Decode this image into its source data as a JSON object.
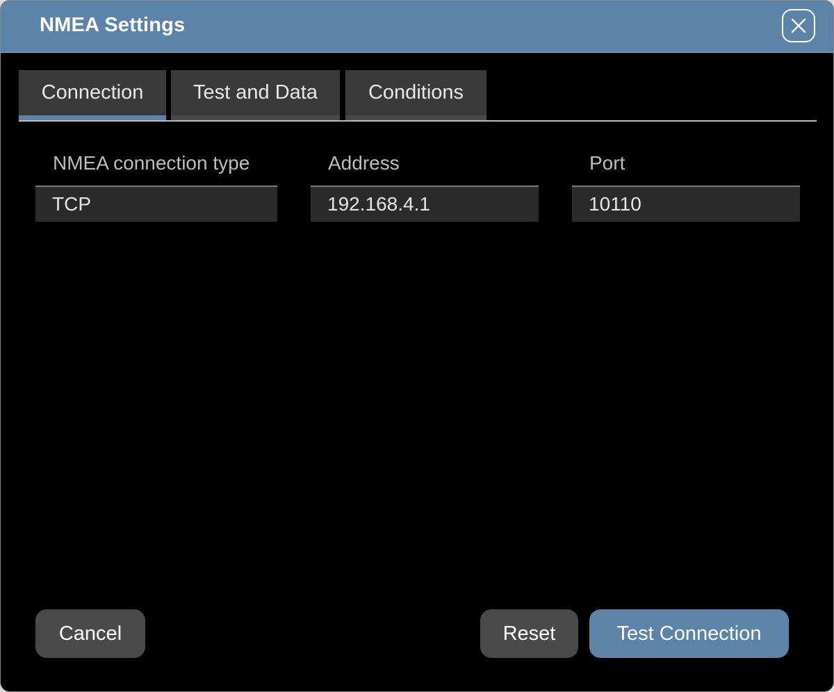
{
  "dialog": {
    "title": "NMEA Settings",
    "close_icon": "close-icon"
  },
  "tabs": [
    {
      "label": "Connection",
      "active": true
    },
    {
      "label": "Test and Data",
      "active": false
    },
    {
      "label": "Conditions",
      "active": false
    }
  ],
  "fields": {
    "connection_type": {
      "label": "NMEA connection type",
      "value": "TCP"
    },
    "address": {
      "label": "Address",
      "value": "192.168.4.1"
    },
    "port": {
      "label": "Port",
      "value": "10110"
    }
  },
  "buttons": {
    "cancel": "Cancel",
    "reset": "Reset",
    "test_connection": "Test Connection"
  },
  "colors": {
    "accent": "#5b84a8",
    "background": "#000000",
    "field_bg": "#2b2b2b",
    "button_secondary": "#4a4a4a"
  }
}
